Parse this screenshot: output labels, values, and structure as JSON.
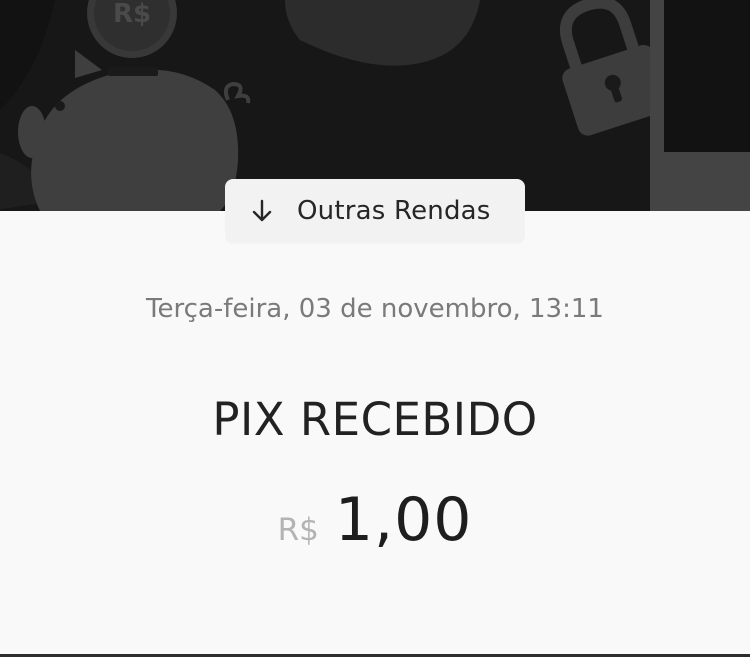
{
  "header": {
    "background_color": "#171717",
    "coin_symbol": "R$",
    "category_label": "Outras Rendas",
    "category_icon": "arrow-down-icon"
  },
  "transaction": {
    "date": "Terça-feira, 03 de novembro, 13:11",
    "title": "PIX RECEBIDO",
    "currency": "R$",
    "amount": "1,00"
  },
  "colors": {
    "page_background": "#f9f9f9",
    "chip_background": "#f2f2f2",
    "muted_text": "#7a7a7a",
    "currency_text": "#b3b3b3"
  }
}
